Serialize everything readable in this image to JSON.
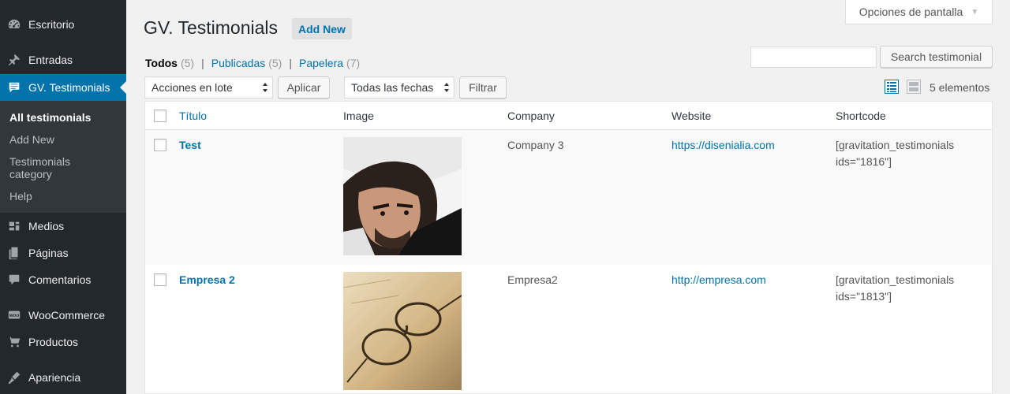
{
  "sidebar": {
    "items": [
      {
        "label": "Escritorio",
        "icon": "dashboard-icon"
      },
      {
        "label": "Entradas",
        "icon": "pin-icon"
      },
      {
        "label": "GV. Testimonials",
        "icon": "testimonial-icon"
      },
      {
        "label": "Medios",
        "icon": "media-icon"
      },
      {
        "label": "Páginas",
        "icon": "pages-icon"
      },
      {
        "label": "Comentarios",
        "icon": "comments-icon"
      },
      {
        "label": "WooCommerce",
        "icon": "woocommerce-icon"
      },
      {
        "label": "Productos",
        "icon": "products-icon"
      },
      {
        "label": "Apariencia",
        "icon": "appearance-icon"
      }
    ],
    "submenu": [
      {
        "label": "All testimonials"
      },
      {
        "label": "Add New"
      },
      {
        "label": "Testimonials category"
      },
      {
        "label": "Help"
      }
    ]
  },
  "header": {
    "title": "GV. Testimonials",
    "add_new": "Add New",
    "screen_options": "Opciones de pantalla"
  },
  "views": {
    "all": {
      "label": "Todos",
      "count": "(5)"
    },
    "published": {
      "label": "Publicadas",
      "count": "(5)"
    },
    "trash": {
      "label": "Papelera",
      "count": "(7)"
    },
    "separator": "|"
  },
  "search": {
    "button": "Search testimonial",
    "value": ""
  },
  "bulk": {
    "bulk_select": "Acciones en lote",
    "apply": "Aplicar",
    "dates_select": "Todas las fechas",
    "filter": "Filtrar"
  },
  "items_count": "5 elementos",
  "table": {
    "columns": [
      "Título",
      "Image",
      "Company",
      "Website",
      "Shortcode"
    ],
    "rows": [
      {
        "title": "Test",
        "company": "Company 3",
        "website": "https://disenialia.com",
        "shortcode_1": "[gravitation_testimonials",
        "shortcode_2": "ids=\"1816\"]",
        "image": "portrait-photo"
      },
      {
        "title": "Empresa 2",
        "company": "Empresa2",
        "website": "http://empresa.com",
        "shortcode_1": "[gravitation_testimonials",
        "shortcode_2": "ids=\"1813\"]",
        "image": "glasses-photo"
      }
    ]
  },
  "colors": {
    "sidebar_bg": "#23282d",
    "accent": "#0073aa",
    "page_bg": "#f1f1f1"
  }
}
